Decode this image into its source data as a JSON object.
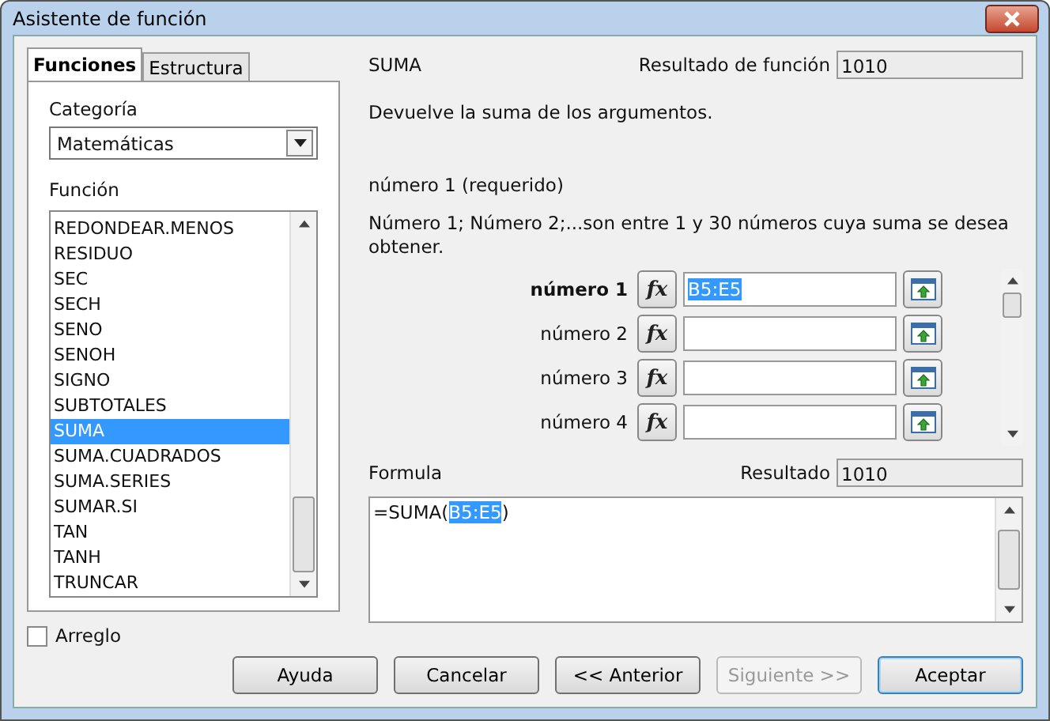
{
  "window": {
    "title": "Asistente de función"
  },
  "tabs": [
    {
      "label": "Funciones",
      "selected": true
    },
    {
      "label": "Estructura",
      "selected": false
    }
  ],
  "category": {
    "label": "Categoría",
    "value": "Matemáticas"
  },
  "function_list": {
    "label": "Función",
    "items": [
      {
        "label": "REDONDEAR.MENOS",
        "selected": false
      },
      {
        "label": "RESIDUO",
        "selected": false
      },
      {
        "label": "SEC",
        "selected": false
      },
      {
        "label": "SECH",
        "selected": false
      },
      {
        "label": "SENO",
        "selected": false
      },
      {
        "label": "SENOH",
        "selected": false
      },
      {
        "label": "SIGNO",
        "selected": false
      },
      {
        "label": "SUBTOTALES",
        "selected": false
      },
      {
        "label": "SUMA",
        "selected": true
      },
      {
        "label": "SUMA.CUADRADOS",
        "selected": false
      },
      {
        "label": "SUMA.SERIES",
        "selected": false
      },
      {
        "label": "SUMAR.SI",
        "selected": false
      },
      {
        "label": "TAN",
        "selected": false
      },
      {
        "label": "TANH",
        "selected": false
      },
      {
        "label": "TRUNCAR",
        "selected": false
      }
    ]
  },
  "array_checkbox": {
    "label": "Arreglo",
    "checked": false
  },
  "function_name": "SUMA",
  "function_result": {
    "label": "Resultado de función",
    "value": "1010"
  },
  "description": "Devuelve la suma de los argumentos.",
  "argument_title": "número 1 (requerido)",
  "argument_description": "Número 1; Número 2;...son entre 1 y 30 números cuya suma se desea obtener.",
  "arguments": [
    {
      "label": "número 1",
      "active": true,
      "function_button": "fx",
      "value": "B5:E5"
    },
    {
      "label": "número 2",
      "active": false,
      "function_button": "fx"
    },
    {
      "label": "número 3",
      "active": false,
      "function_button": "fx"
    },
    {
      "label": "número 4",
      "active": false,
      "function_button": "fx"
    }
  ],
  "formula": {
    "label": "Formula",
    "before": "=SUMA(",
    "selected": "B5:E5",
    "after": ")"
  },
  "result": {
    "label": "Resultado",
    "value": "1010"
  },
  "buttons": [
    {
      "label": "Ayuda",
      "kind": "normal",
      "disabled": false
    },
    {
      "label": "Cancelar",
      "kind": "normal",
      "disabled": false
    },
    {
      "label": "<< Anterior",
      "kind": "normal",
      "disabled": false
    },
    {
      "label": "Siguiente >>",
      "kind": "normal",
      "disabled": true
    },
    {
      "label": "Aceptar",
      "kind": "default",
      "disabled": false
    }
  ]
}
